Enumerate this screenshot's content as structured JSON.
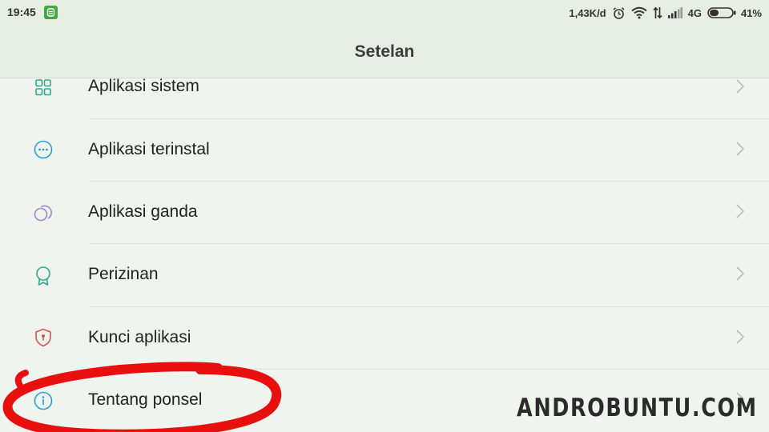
{
  "status_bar": {
    "time": "19:45",
    "net_speed": "1,43K/d",
    "network_type": "4G",
    "battery_percent": "41%",
    "battery_level": 0.41,
    "icons": [
      "notification-app-icon",
      "alarm-icon",
      "wifi-icon",
      "data-activity-icon",
      "signal-icon",
      "battery-icon"
    ]
  },
  "header": {
    "title": "Setelan"
  },
  "settings": {
    "items": [
      {
        "label": "Aplikasi sistem",
        "icon": "grid-icon",
        "color": "#2fa88c"
      },
      {
        "label": "Aplikasi terinstal",
        "icon": "more-circle-icon",
        "color": "#2e9ed4"
      },
      {
        "label": "Aplikasi ganda",
        "icon": "dual-circles-icon",
        "color": "#9b85d6"
      },
      {
        "label": "Perizinan",
        "icon": "badge-icon",
        "color": "#2fa88c"
      },
      {
        "label": "Kunci aplikasi",
        "icon": "shield-icon",
        "color": "#d9534f"
      },
      {
        "label": "Tentang ponsel",
        "icon": "info-icon",
        "color": "#2e9ed4"
      }
    ]
  },
  "annotation": {
    "highlighted_item": "Tentang ponsel",
    "color": "#e8100f"
  },
  "watermark": "ANDROBUNTU.COM"
}
